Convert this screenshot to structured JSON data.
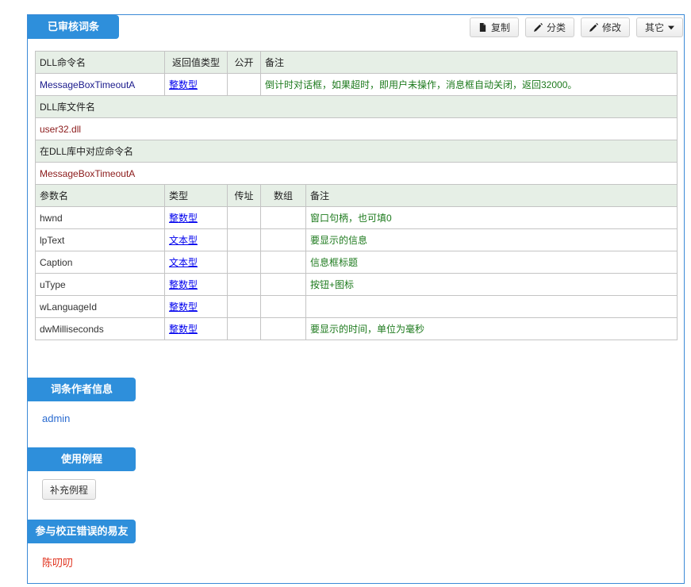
{
  "header": {
    "title": "已审核词条"
  },
  "toolbar": {
    "copy": "复制",
    "classify": "分类",
    "edit": "修改",
    "other": "其它"
  },
  "dll": {
    "col_name": "DLL命令名",
    "col_return": "返回值类型",
    "col_public": "公开",
    "col_note": "备注",
    "name": "MessageBoxTimeoutA",
    "return_type": "整数型",
    "public": "",
    "note": "倒计时对话框，如果超时，即用户未操作，消息框自动关闭，返回32000。",
    "lib_label": "DLL库文件名",
    "lib_value": "user32.dll",
    "cmd_label": "在DLL库中对应命令名",
    "cmd_value": "MessageBoxTimeoutA"
  },
  "params": {
    "headers": [
      "参数名",
      "类型",
      "传址",
      "数组",
      "备注"
    ],
    "rows": [
      {
        "name": "hwnd",
        "type": "整数型",
        "byref": "",
        "array": "",
        "note": "窗口句柄，也可填0"
      },
      {
        "name": "lpText",
        "type": "文本型",
        "byref": "",
        "array": "",
        "note": "要显示的信息"
      },
      {
        "name": "Caption",
        "type": "文本型",
        "byref": "",
        "array": "",
        "note": "信息框标题"
      },
      {
        "name": "uType",
        "type": "整数型",
        "byref": "",
        "array": "",
        "note": "按钮+图标"
      },
      {
        "name": "wLanguageId",
        "type": "整数型",
        "byref": "",
        "array": "",
        "note": ""
      },
      {
        "name": "dwMilliseconds",
        "type": "整数型",
        "byref": "",
        "array": "",
        "note": "要显示的时间，单位为毫秒"
      }
    ]
  },
  "author": {
    "title": "词条作者信息",
    "name": "admin"
  },
  "examples": {
    "title": "使用例程",
    "add_button": "补充例程"
  },
  "contributors": {
    "title": "参与校正错误的易友",
    "name": "陈叨叨"
  }
}
